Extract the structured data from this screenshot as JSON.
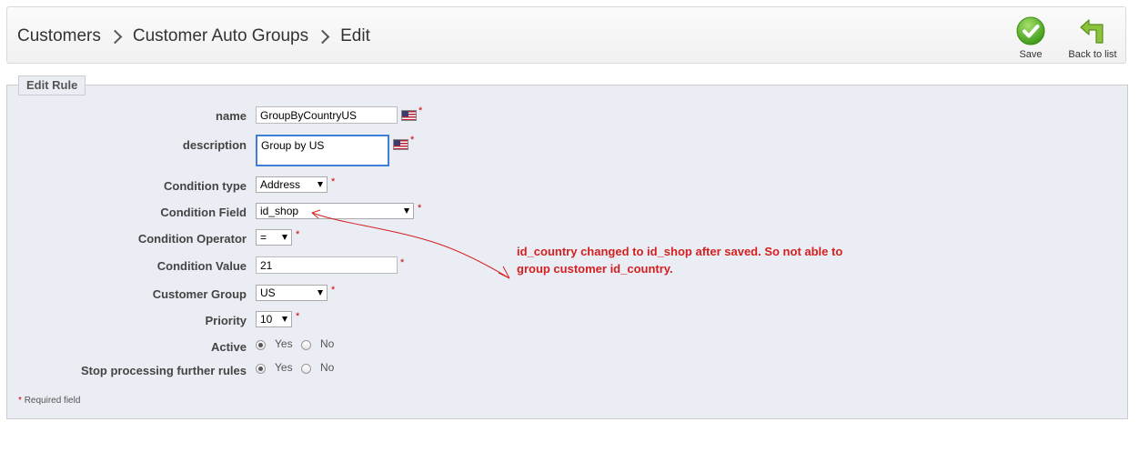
{
  "breadcrumb": [
    "Customers",
    "Customer Auto Groups",
    "Edit"
  ],
  "toolbar": {
    "save_label": "Save",
    "back_label": "Back to list"
  },
  "form": {
    "legend": "Edit Rule",
    "name": {
      "label": "name",
      "value": "GroupByCountryUS"
    },
    "description": {
      "label": "description",
      "value": "Group by US"
    },
    "condition_type": {
      "label": "Condition type",
      "value": "Address"
    },
    "condition_field": {
      "label": "Condition Field",
      "value": "id_shop"
    },
    "condition_operator": {
      "label": "Condition Operator",
      "value": "="
    },
    "condition_value": {
      "label": "Condition Value",
      "value": "21"
    },
    "customer_group": {
      "label": "Customer Group",
      "value": "US"
    },
    "priority": {
      "label": "Priority",
      "value": "10"
    },
    "active": {
      "label": "Active",
      "yes": "Yes",
      "no": "No",
      "selected": "Yes"
    },
    "stop_processing": {
      "label": "Stop processing further rules",
      "yes": "Yes",
      "no": "No",
      "selected": "Yes"
    },
    "required_star": "*",
    "required_note": "Required field"
  },
  "annotation": {
    "text": "id_country changed to id_shop after saved. So not able to group customer id_country.",
    "color": "#d42020"
  },
  "colors": {
    "save_green": "#5cb82a",
    "panel_bg": "#ebedf4",
    "required": "#cc0000"
  },
  "icons": {
    "save": "checkmark-circle-icon",
    "back": "back-arrow-icon",
    "language": "us-flag-icon"
  }
}
